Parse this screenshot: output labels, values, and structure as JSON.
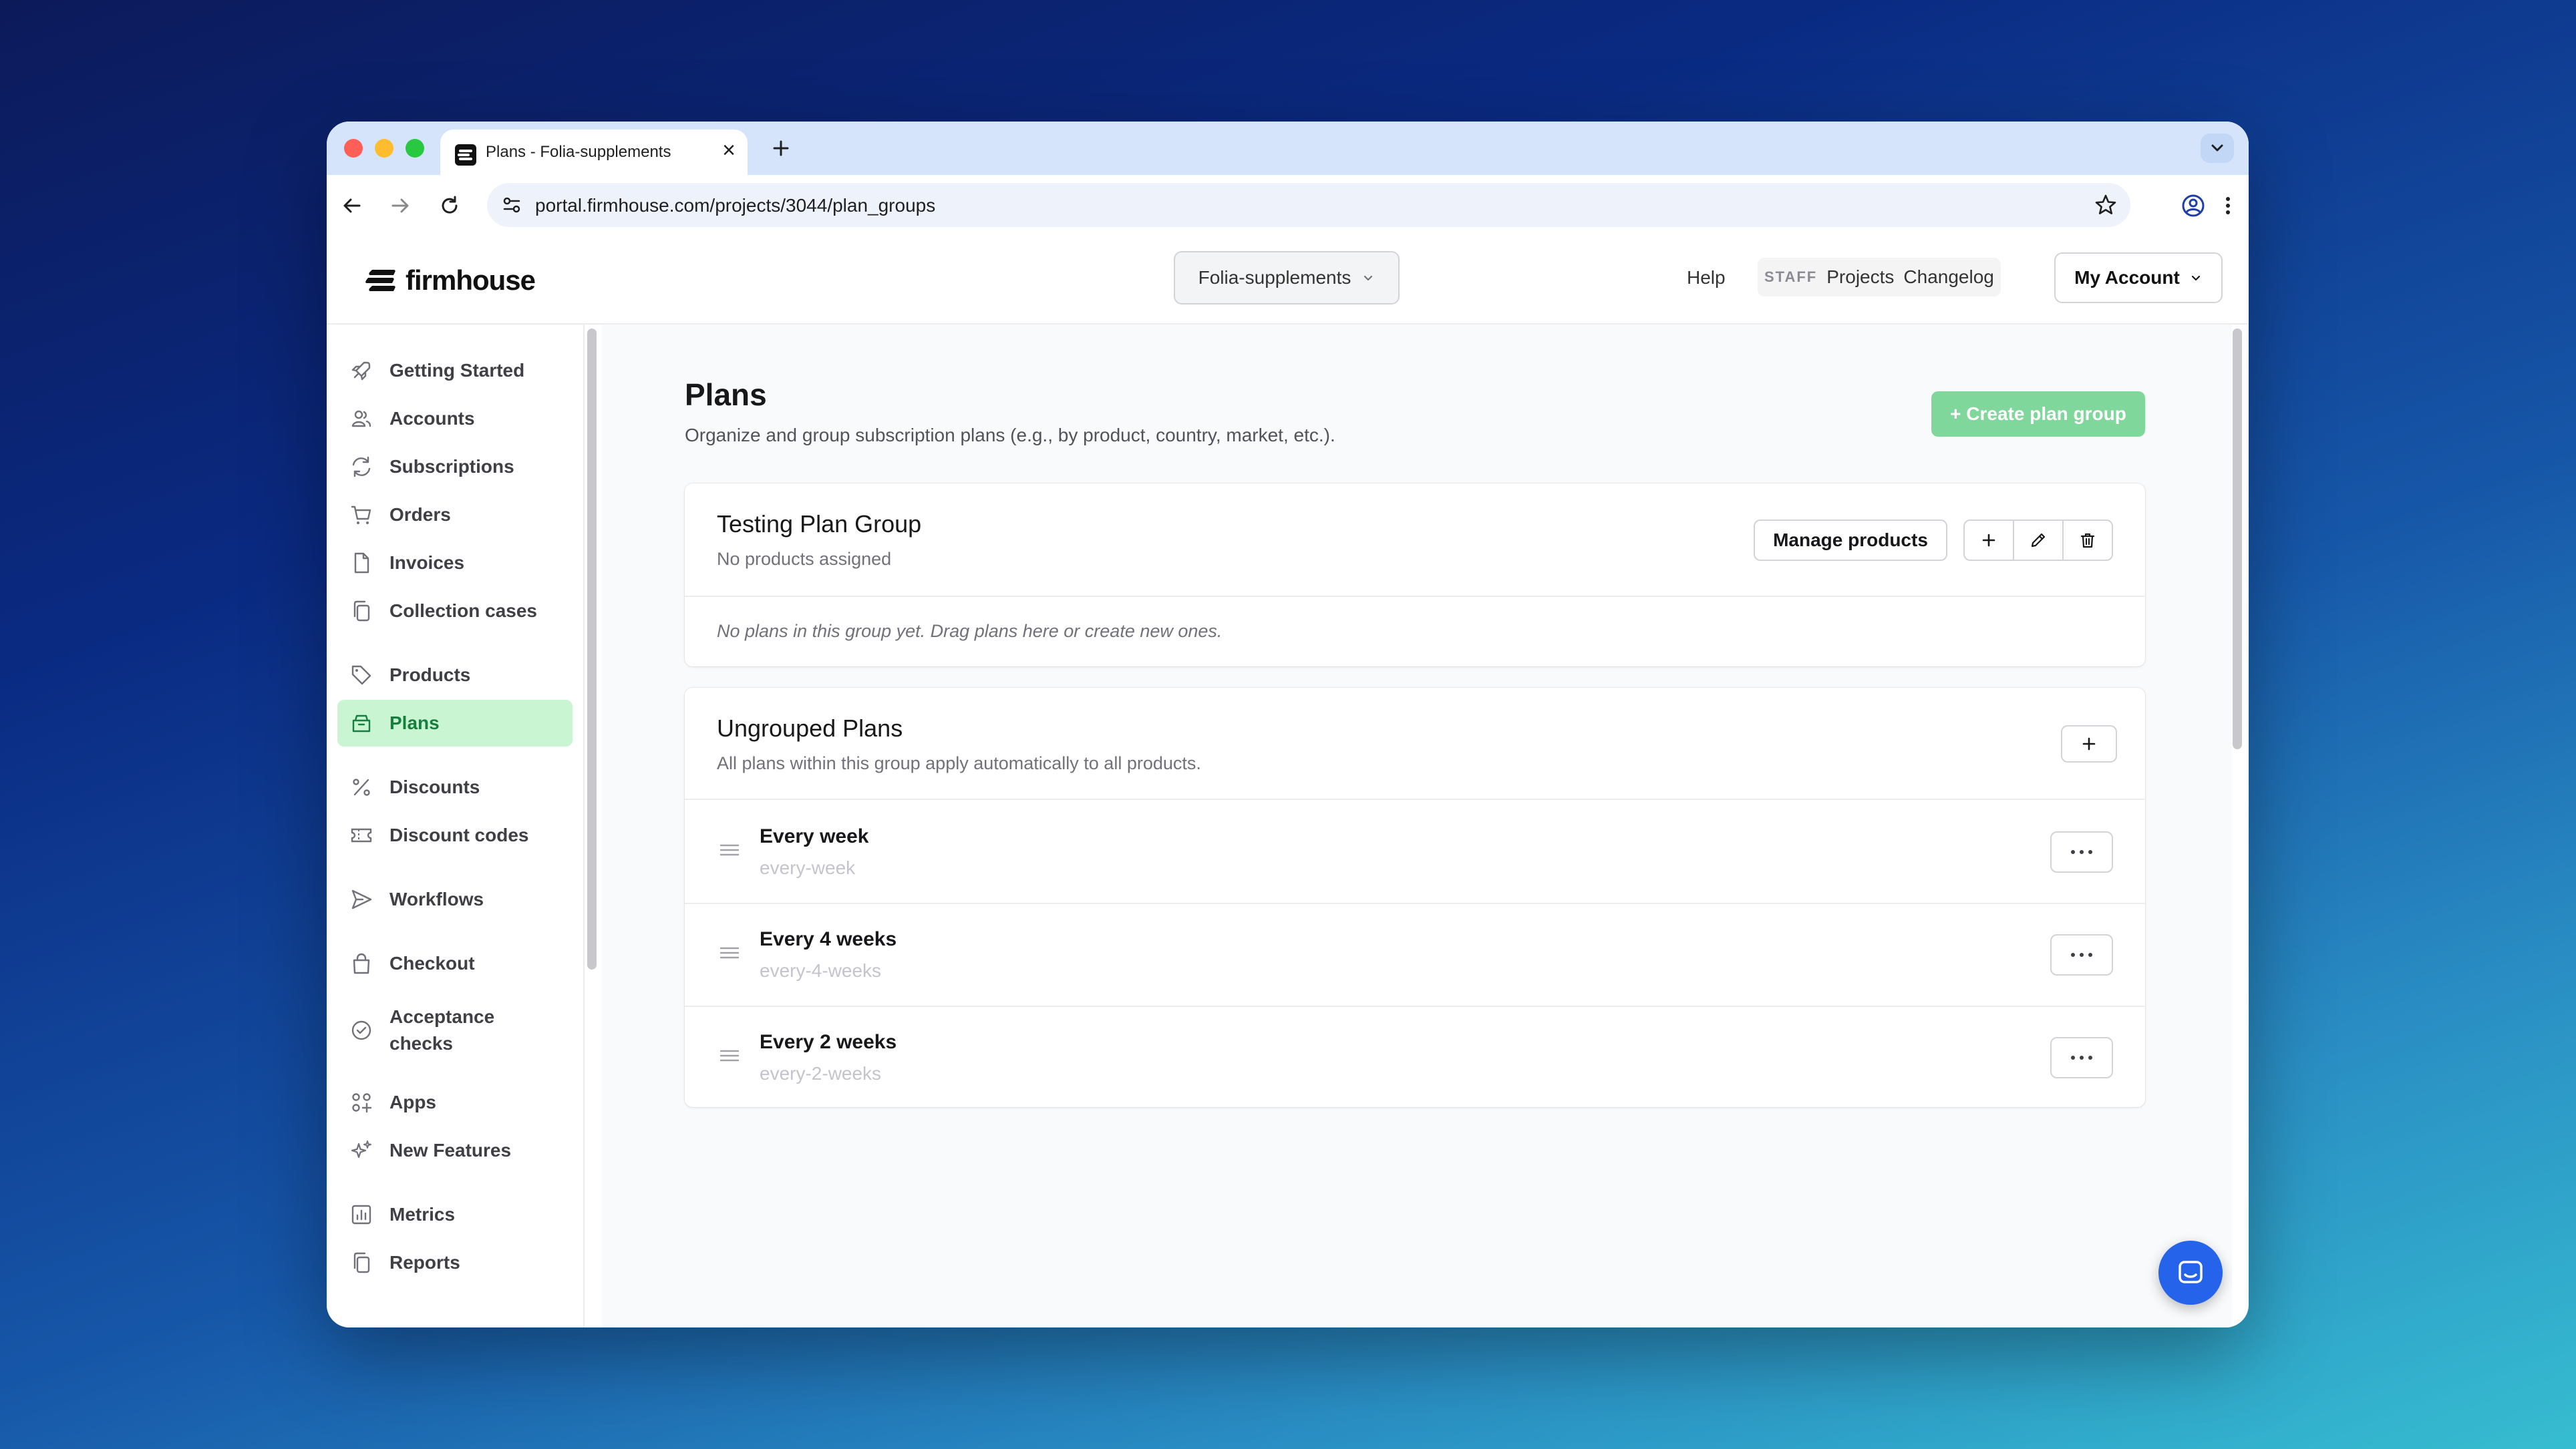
{
  "browser": {
    "tab_title": "Plans - Folia-supplements",
    "url": "portal.firmhouse.com/projects/3044/plan_groups"
  },
  "header": {
    "logo_text": "firmhouse",
    "project_name": "Folia-supplements",
    "help_label": "Help",
    "staff_badge": "STAFF",
    "projects_label": "Projects",
    "changelog_label": "Changelog",
    "account_label": "My Account"
  },
  "sidebar": {
    "items": [
      {
        "label": "Getting Started",
        "icon": "rocket-icon"
      },
      {
        "label": "Accounts",
        "icon": "users-icon"
      },
      {
        "label": "Subscriptions",
        "icon": "refresh-icon"
      },
      {
        "label": "Orders",
        "icon": "cart-icon"
      },
      {
        "label": "Invoices",
        "icon": "document-icon"
      },
      {
        "label": "Collection cases",
        "icon": "copy-icon"
      },
      {
        "label": "Products",
        "icon": "tag-icon"
      },
      {
        "label": "Plans",
        "icon": "archive-icon",
        "active": true
      },
      {
        "label": "Discounts",
        "icon": "percent-icon"
      },
      {
        "label": "Discount codes",
        "icon": "ticket-icon"
      },
      {
        "label": "Workflows",
        "icon": "send-icon"
      },
      {
        "label": "Checkout",
        "icon": "bag-icon"
      },
      {
        "label": "Acceptance\nchecks",
        "icon": "check-circle-icon"
      },
      {
        "label": "Apps",
        "icon": "apps-icon"
      },
      {
        "label": "New Features",
        "icon": "sparkles-icon"
      },
      {
        "label": "Metrics",
        "icon": "chart-icon"
      },
      {
        "label": "Reports",
        "icon": "reports-icon"
      }
    ]
  },
  "main": {
    "title": "Plans",
    "subtitle": "Organize and group subscription plans (e.g., by product, country, market, etc.).",
    "create_button": "+ Create plan group",
    "testing_group": {
      "title": "Testing Plan Group",
      "subtitle": "No products assigned",
      "manage_button": "Manage products",
      "empty_note": "No plans in this group yet. Drag plans here or create new ones."
    },
    "ungrouped": {
      "title": "Ungrouped Plans",
      "subtitle": "All plans within this group apply automatically to all products.",
      "plans": [
        {
          "name": "Every week",
          "slug": "every-week"
        },
        {
          "name": "Every 4 weeks",
          "slug": "every-4-weeks"
        },
        {
          "name": "Every 2 weeks",
          "slug": "every-2-weeks"
        }
      ]
    }
  },
  "colors": {
    "accent_green": "#7fd79b",
    "active_bg": "#c9f5d3",
    "chat_blue": "#2563eb"
  }
}
